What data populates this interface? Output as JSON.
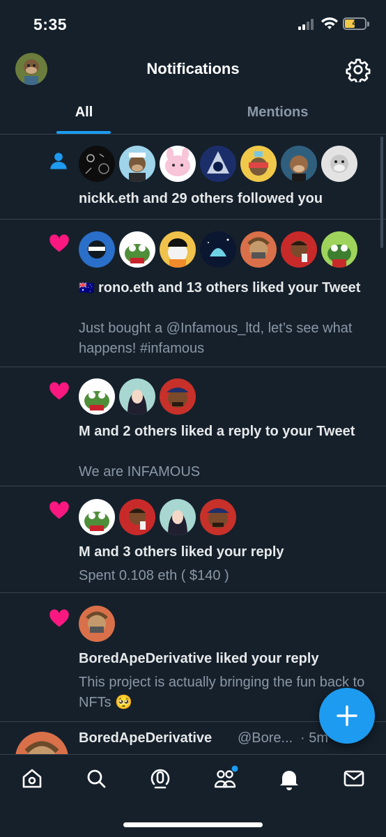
{
  "status_bar": {
    "time": "5:35",
    "battery": "4"
  },
  "header": {
    "title": "Notifications",
    "avatar_icon": "ape-avatar",
    "settings_icon": "gear-icon"
  },
  "tabs": [
    {
      "label": "All",
      "active": true
    },
    {
      "label": "Mentions",
      "active": false
    }
  ],
  "notifications": [
    {
      "type": "follow",
      "icon": "person-icon",
      "avatar_count": 7,
      "text": "nickk.eth and 29 others followed you",
      "subtext": ""
    },
    {
      "type": "like",
      "icon": "heart-icon",
      "avatar_count": 8,
      "flag": "🇦🇺",
      "text": "rono.eth and 13 others liked your Tweet",
      "subtext": "Just bought a @Infamous_ltd, let’s see what happens! #infamous"
    },
    {
      "type": "like",
      "icon": "heart-icon",
      "avatar_count": 3,
      "text": "M and 2 others liked a reply to your Tweet",
      "subtext": "We are INFAMOUS"
    },
    {
      "type": "like",
      "icon": "heart-icon",
      "avatar_count": 4,
      "text": "M and 3 others liked your reply",
      "subtext": "Spent 0.108 eth ( $140 )"
    },
    {
      "type": "like",
      "icon": "heart-icon",
      "avatar_count": 1,
      "text": "BoredApeDerivative liked your reply",
      "subtext": "This project is actually bringing the fun back to NFTs",
      "emoji": "🥺"
    }
  ],
  "tweet_preview": {
    "name": "BoredApeDerivative",
    "handle": "@Bore...",
    "time": "· 5m",
    "more": "···"
  },
  "fab": {
    "icon": "plus-icon"
  },
  "bottom_nav": [
    {
      "icon": "home-icon"
    },
    {
      "icon": "search-icon"
    },
    {
      "icon": "spaces-icon"
    },
    {
      "icon": "communities-icon",
      "badge": true
    },
    {
      "icon": "bell-icon",
      "active": true
    },
    {
      "icon": "mail-icon"
    }
  ],
  "colors": {
    "background": "#15202b",
    "accent": "#1d9bf0",
    "like": "#f91880",
    "muted": "#8b98a5",
    "divider": "#38444d"
  }
}
